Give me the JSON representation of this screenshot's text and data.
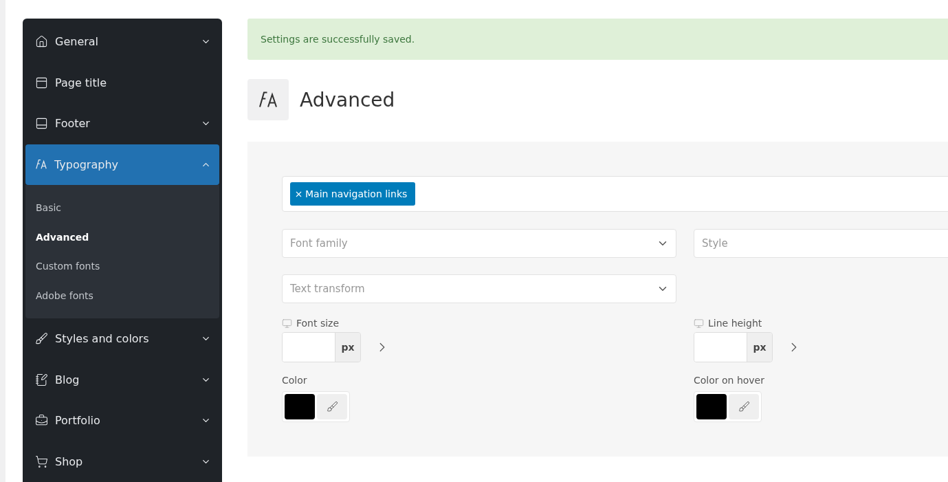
{
  "sidebar": {
    "items": [
      {
        "label": "General",
        "kind": "group",
        "selected": false,
        "expanded": false
      },
      {
        "label": "Page title",
        "kind": "link",
        "selected": false
      },
      {
        "label": "Footer",
        "kind": "group",
        "selected": false,
        "expanded": false
      },
      {
        "label": "Typography",
        "kind": "group",
        "selected": true,
        "expanded": true,
        "children": [
          {
            "label": "Basic",
            "selected": false
          },
          {
            "label": "Advanced",
            "selected": true
          },
          {
            "label": "Custom fonts",
            "selected": false
          },
          {
            "label": "Adobe fonts",
            "selected": false
          }
        ]
      },
      {
        "label": "Styles and colors",
        "kind": "group",
        "selected": false,
        "expanded": false
      },
      {
        "label": "Blog",
        "kind": "group",
        "selected": false,
        "expanded": false
      },
      {
        "label": "Portfolio",
        "kind": "group",
        "selected": false,
        "expanded": false
      },
      {
        "label": "Shop",
        "kind": "group",
        "selected": false,
        "expanded": false
      }
    ]
  },
  "notice": {
    "text": "Settings are successfully saved."
  },
  "header": {
    "title": "Advanced"
  },
  "panel": {
    "tags": [
      "Main navigation links"
    ],
    "selects": [
      {
        "placeholder": "Font family"
      },
      {
        "placeholder": "Style"
      },
      {
        "placeholder": "Text transform"
      }
    ],
    "sizes": [
      {
        "label": "Font size",
        "unit": "px"
      },
      {
        "label": "Line height",
        "unit": "px"
      }
    ],
    "colors": [
      {
        "label": "Color",
        "color": "#000000"
      },
      {
        "label": "Color on hover",
        "color": "#000000"
      }
    ]
  }
}
